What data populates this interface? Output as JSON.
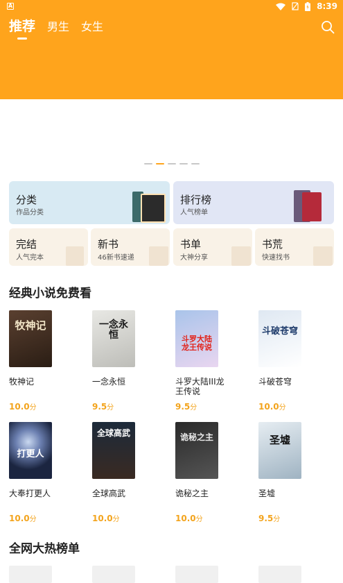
{
  "status_bar": {
    "time": "8:39",
    "left_icon": "A"
  },
  "header": {
    "tabs": [
      {
        "label": "推荐",
        "active": true
      },
      {
        "label": "男生",
        "active": false
      },
      {
        "label": "女生",
        "active": false
      }
    ],
    "background_color": "#FFA41C"
  },
  "banner": {
    "page_count": 5,
    "active_index": 1
  },
  "categories": {
    "large": [
      {
        "title": "分类",
        "subtitle": "作品分类"
      },
      {
        "title": "排行榜",
        "subtitle": "人气榜单"
      }
    ],
    "small": [
      {
        "title": "完结",
        "subtitle": "人气完本"
      },
      {
        "title": "新书",
        "subtitle": "46新书速递"
      },
      {
        "title": "书单",
        "subtitle": "大神分享"
      },
      {
        "title": "书荒",
        "subtitle": "快速找书"
      }
    ]
  },
  "section_classic": {
    "title": "经典小说免费看",
    "books": [
      {
        "title": "牧神记",
        "score": "10.0",
        "unit": "分",
        "cover_text": "牧神记"
      },
      {
        "title": "一念永恒",
        "score": "9.5",
        "unit": "分",
        "cover_text": "一念永恒"
      },
      {
        "title": "斗罗大陆III龙王传说",
        "score": "9.5",
        "unit": "分",
        "cover_text": "斗罗大陆 龙王传说"
      },
      {
        "title": "斗破苍穹",
        "score": "10.0",
        "unit": "分",
        "cover_text": "斗破苍穹"
      },
      {
        "title": "大奉打更人",
        "score": "10.0",
        "unit": "分",
        "cover_text": "打更人"
      },
      {
        "title": "全球高武",
        "score": "10.0",
        "unit": "分",
        "cover_text": "全球高武"
      },
      {
        "title": "诡秘之主",
        "score": "10.0",
        "unit": "分",
        "cover_text": "诡秘之主"
      },
      {
        "title": "圣墟",
        "score": "9.5",
        "unit": "分",
        "cover_text": "圣墟"
      }
    ]
  },
  "section_hot": {
    "title": "全网大热榜单"
  }
}
